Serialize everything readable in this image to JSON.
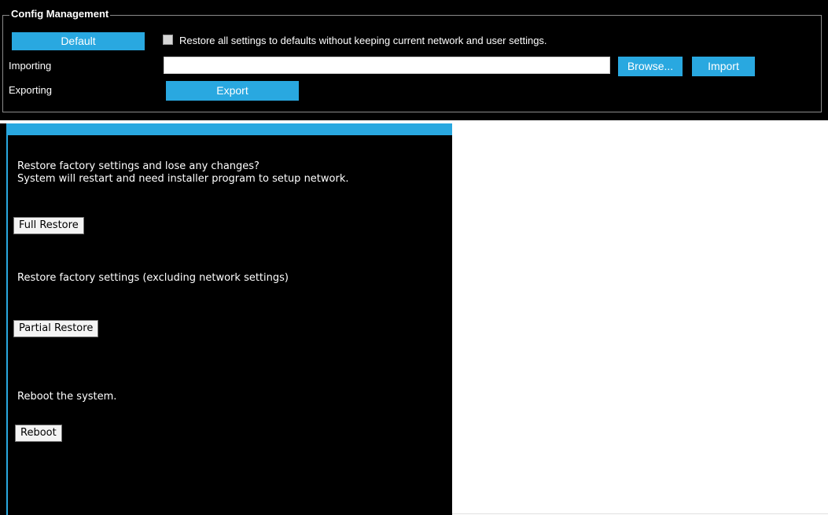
{
  "config": {
    "legend": "Config Management",
    "default_button": "Default",
    "restore_checkbox_label": "Restore all settings to defaults without keeping current network and user settings.",
    "restore_checked": false,
    "importing_label": "Importing",
    "import_file_value": "",
    "browse_button": "Browse...",
    "import_button": "Import",
    "exporting_label": "Exporting",
    "export_button": "Export"
  },
  "restore": {
    "full_msg_line1": "Restore factory settings and lose any changes?",
    "full_msg_line2": "System will restart and need installer program to setup network.",
    "full_button": "Full Restore",
    "partial_msg": "Restore factory settings (excluding network settings)",
    "partial_button": "Partial Restore",
    "reboot_msg": "Reboot the system.",
    "reboot_button": "Reboot"
  },
  "colors": {
    "accent": "#29a8e0",
    "panel_bg": "#000000",
    "text": "#ffffff"
  }
}
